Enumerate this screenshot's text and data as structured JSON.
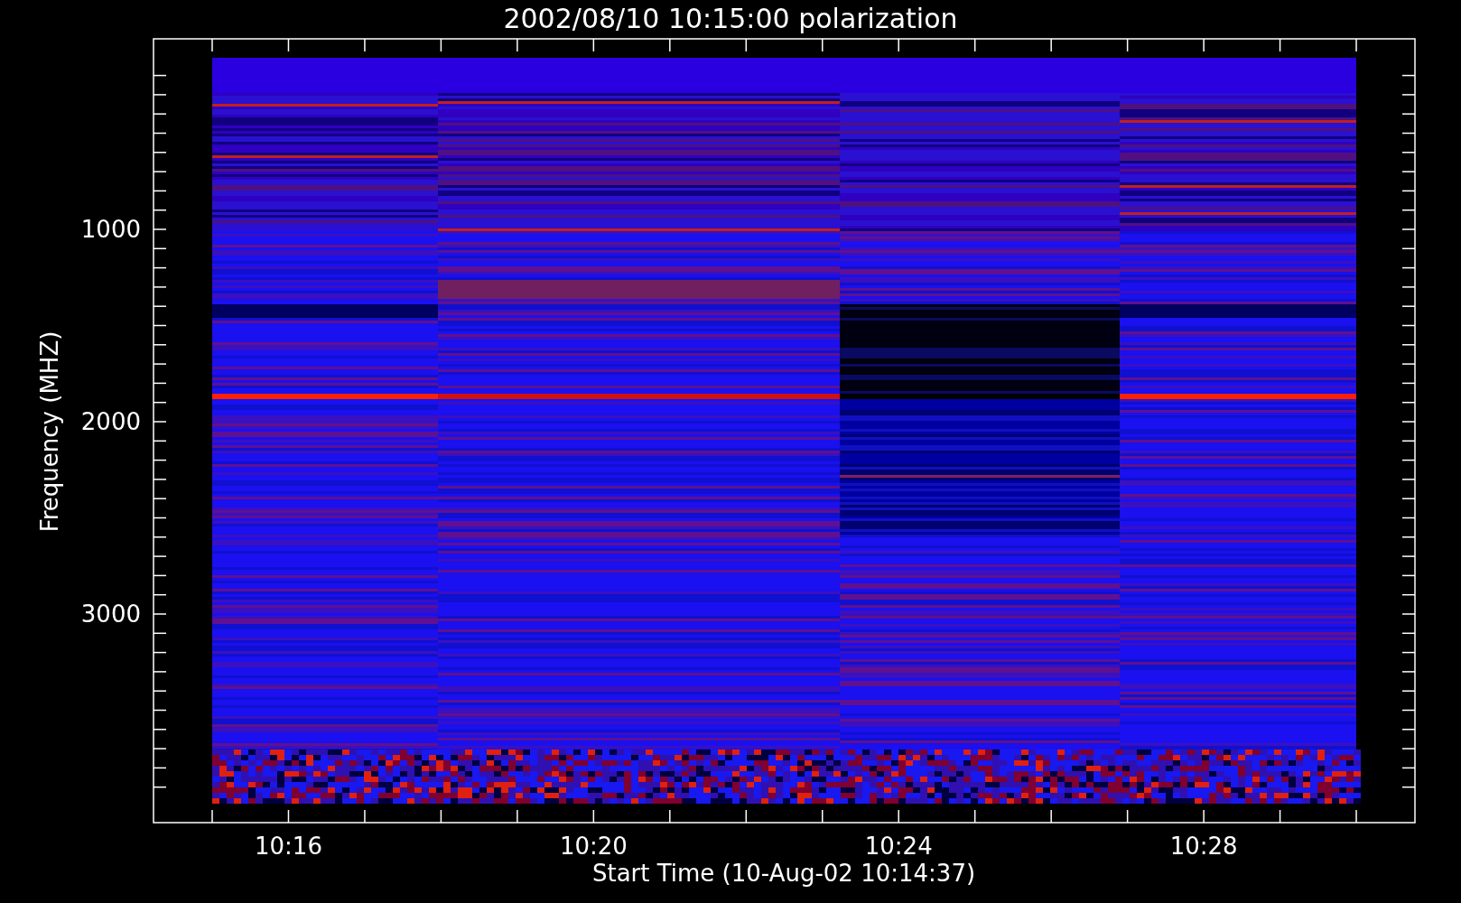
{
  "title": "2002/08/10 10:15:00 polarization",
  "y_axis": {
    "label": "Frequency (MHZ)",
    "ticks": [
      "1000",
      "2000",
      "3000"
    ]
  },
  "x_axis": {
    "label": "Start Time (10-Aug-02 10:14:37)",
    "ticks": [
      "10:16",
      "10:20",
      "10:24",
      "10:28"
    ]
  }
}
